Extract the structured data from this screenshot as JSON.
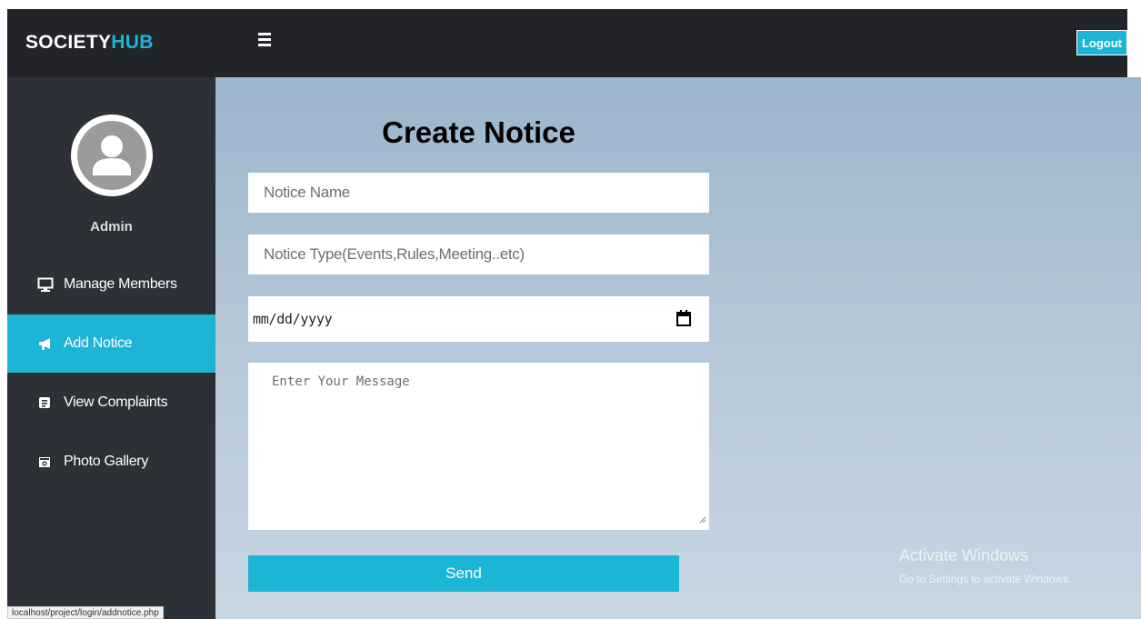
{
  "header": {
    "brand_part1": "SOCIETY",
    "brand_part2": "HUB",
    "logout_label": "Logout"
  },
  "sidebar": {
    "user_name": "Admin",
    "items": [
      {
        "label": "Manage Members",
        "icon": "monitor-icon"
      },
      {
        "label": "Add Notice",
        "icon": "megaphone-icon",
        "active": true
      },
      {
        "label": "View Complaints",
        "icon": "complaint-icon"
      },
      {
        "label": "Photo Gallery",
        "icon": "camera-icon"
      }
    ]
  },
  "form": {
    "title": "Create Notice",
    "notice_name_placeholder": "Notice Name",
    "notice_type_placeholder": "Notice Type(Events,Rules,Meeting..etc)",
    "date_placeholder": "mm/dd/yyyy",
    "message_placeholder": "Enter Your Message",
    "send_label": "Send"
  },
  "status_bar": {
    "url": "localhost/project/login/addnotice.php"
  },
  "watermark": {
    "title": "Activate Windows",
    "subtitle": "Go to Settings to activate Windows."
  },
  "colors": {
    "accent": "#1cb5d6",
    "topbar": "#222429",
    "sidebar": "#2e3037"
  }
}
